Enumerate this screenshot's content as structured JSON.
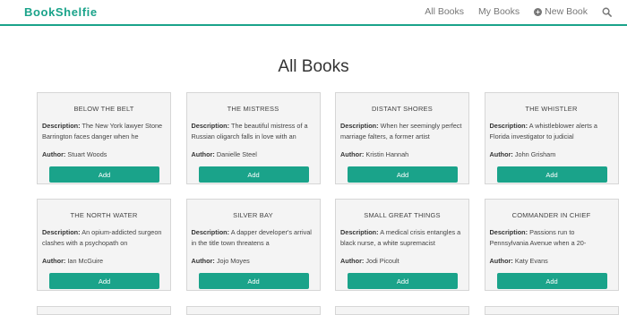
{
  "navbar": {
    "brand": "BookShelfie",
    "links": {
      "all_books": "All Books",
      "my_books": "My Books",
      "new_book": "New Book"
    }
  },
  "page": {
    "title": "All Books"
  },
  "labels": {
    "description": "Description:",
    "author": "Author:",
    "add_button": "Add"
  },
  "books": [
    {
      "title": "BELOW THE BELT",
      "description": "The New York lawyer Stone Barrington faces danger when he",
      "author": "Stuart Woods"
    },
    {
      "title": "THE MISTRESS",
      "description": "The beautiful mistress of a Russian oligarch falls in love with an",
      "author": "Danielle Steel"
    },
    {
      "title": "DISTANT SHORES",
      "description": "When her seemingly perfect marriage falters, a former artist",
      "author": "Kristin Hannah"
    },
    {
      "title": "THE WHISTLER",
      "description": "A whistleblower alerts a Florida investigator to judicial",
      "author": "John Grisham"
    },
    {
      "title": "THE NORTH WATER",
      "description": "An opium-addicted surgeon clashes with a psychopath on",
      "author": "Ian McGuire"
    },
    {
      "title": "SILVER BAY",
      "description": "A dapper developer's arrival in the title town threatens a",
      "author": "Jojo Moyes"
    },
    {
      "title": "SMALL GREAT THINGS",
      "description": "A medical crisis entangles a black nurse, a white supremacist",
      "author": "Jodi Picoult"
    },
    {
      "title": "COMMANDER IN CHIEF",
      "description": "Passions run to Pennsylvania Avenue when a 20-",
      "author": "Katy Evans"
    }
  ],
  "colors": {
    "accent": "#1aa38a",
    "card_bg": "#f4f4f4"
  }
}
